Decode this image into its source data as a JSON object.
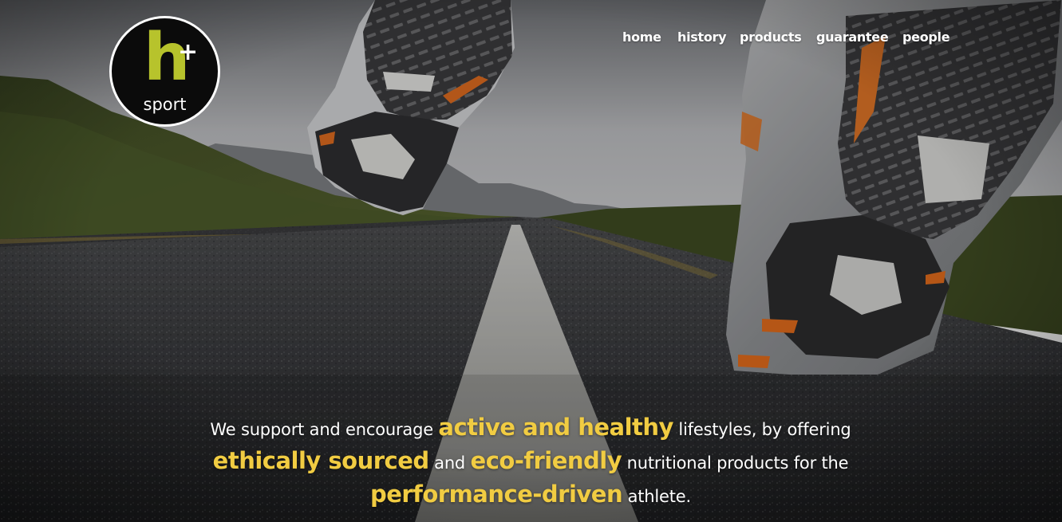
{
  "brand": {
    "logo_letter": "h",
    "logo_plus": "+",
    "logo_word": "sport",
    "letter_color": "#b7c32c",
    "highlight_color": "#f1cc42"
  },
  "nav": {
    "items": [
      {
        "label": "home"
      },
      {
        "label": "history"
      },
      {
        "label": "products"
      },
      {
        "label": "guarantee"
      },
      {
        "label": "people"
      }
    ]
  },
  "hero": {
    "image": "running-shoes-on-road-photo",
    "tagline": {
      "p1": "We support and encourage ",
      "h1": "active and healthy",
      "p2": " lifestyles, by offering",
      "h2": "ethically sourced",
      "p3": " and ",
      "h3": "eco-friendly",
      "p4": " nutritional products for the",
      "h4": "performance-driven",
      "p5": " athlete."
    }
  }
}
